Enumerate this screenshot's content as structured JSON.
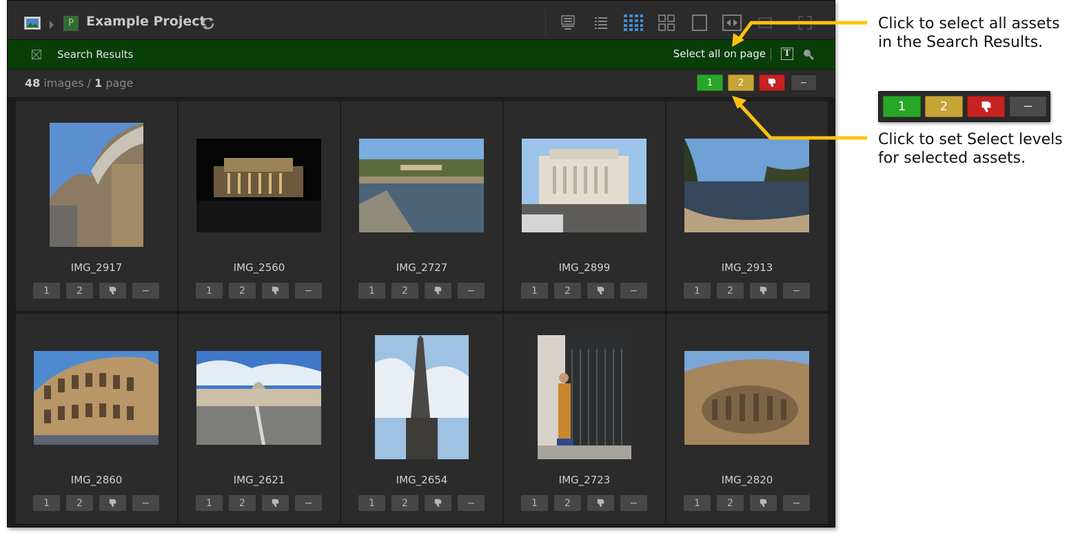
{
  "topbar": {
    "title": "Example Project",
    "project_badge": "P"
  },
  "search_bar": {
    "title": "Search Results",
    "select_all": "Select all on page"
  },
  "status": {
    "image_count": "48",
    "images_label": "images",
    "separator": "/",
    "page_count": "1",
    "page_label": "page"
  },
  "select_levels": {
    "level1": "1",
    "level2": "2",
    "minus": "−"
  },
  "assets": [
    {
      "name": "IMG_2917"
    },
    {
      "name": "IMG_2560"
    },
    {
      "name": "IMG_2727"
    },
    {
      "name": "IMG_2899"
    },
    {
      "name": "IMG_2913"
    },
    {
      "name": "IMG_2860"
    },
    {
      "name": "IMG_2621"
    },
    {
      "name": "IMG_2654"
    },
    {
      "name": "IMG_2723"
    },
    {
      "name": "IMG_2820"
    }
  ],
  "card_buttons": {
    "b1": "1",
    "b2": "2",
    "minus": "−"
  },
  "annotations": {
    "select_all_note": "Click to select all assets in the Search Results.",
    "select_levels_note": "Click to set Select levels for selected assets."
  },
  "colors": {
    "green": "#28a628",
    "yellow": "#c5a536",
    "red": "#c62222",
    "callout": "#ffc20e",
    "search_bar": "#083e08"
  }
}
